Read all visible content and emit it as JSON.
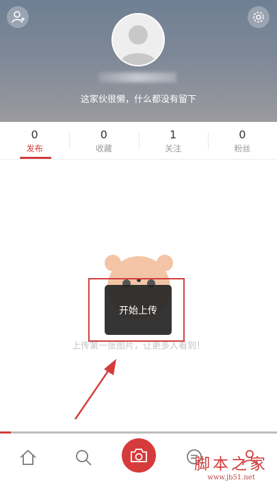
{
  "profile": {
    "bio": "这家伙很懒，什么都没有留下"
  },
  "stats": [
    {
      "count": "0",
      "label": "发布"
    },
    {
      "count": "0",
      "label": "收藏"
    },
    {
      "count": "1",
      "label": "关注"
    },
    {
      "count": "0",
      "label": "粉丝"
    }
  ],
  "active_tab": "发布",
  "empty_state": {
    "text": "上传第一张图片，让更多人看到！"
  },
  "toast": {
    "text": "开始上传"
  },
  "upload_progress": 0.04,
  "bottom_nav": [
    "home-icon",
    "search-icon",
    "camera-icon",
    "message-icon",
    "profile-icon"
  ],
  "colors": {
    "accent": "#d03b3b",
    "header_top": "#6f7f93",
    "toast_bg": "#242424"
  },
  "watermark": {
    "title": "脚本之家",
    "url": "www.jb51.net"
  }
}
